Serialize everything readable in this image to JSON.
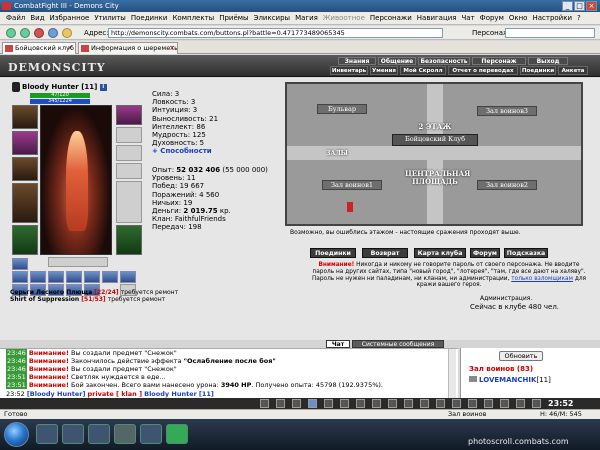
{
  "window": {
    "title": "CombatFight III - Demons City"
  },
  "menu": [
    "Файл",
    "Вид",
    "Избранное",
    "Утилиты",
    "Поединки",
    "Комплекты",
    "Приёмы",
    "Эликсиры",
    "Магия",
    "Живоотное",
    "Персонажи",
    "Навигация",
    "Чат",
    "Форум",
    "Окно",
    "Настройки",
    "?"
  ],
  "address": {
    "label": "Адрес:",
    "url": "http://demonscity.combats.com/buttons.pl?battle=0.471773489065345",
    "person_label": "Персонаж:"
  },
  "tabs": [
    {
      "label": "Бойцовский клуб"
    },
    {
      "label": "Информация о шереметьев"
    }
  ],
  "game": {
    "logo": "DEMONSCITY",
    "topnav": [
      "Знания",
      "Общение",
      "Безопасность",
      "Персонаж",
      "Выход"
    ],
    "subnav": [
      "Инвентарь",
      "Умения",
      "Мой Скролл",
      "Отчет о переводах",
      "Поединки",
      "Анкета"
    ]
  },
  "character": {
    "name": "Bloody Hunter",
    "level": "[11]",
    "hp": "47/120",
    "mana": "345/1224",
    "stats": [
      {
        "label": "Сила:",
        "value": "3"
      },
      {
        "label": "Ловкость:",
        "value": "3"
      },
      {
        "label": "Интуиция:",
        "value": "3"
      },
      {
        "label": "Выносливость:",
        "value": "21"
      },
      {
        "label": "Интеллект:",
        "value": "86"
      },
      {
        "label": "Мудрость:",
        "value": "125"
      },
      {
        "label": "Духовность:",
        "value": "5"
      }
    ],
    "abilities_link": "+ Способности",
    "info": [
      {
        "label": "Опыт:",
        "value": "52 032 406",
        "extra": " (55 000 000)",
        "bold": true
      },
      {
        "label": "Уровень:",
        "value": "11",
        "extra": "",
        "bold": false
      },
      {
        "label": "Побед:",
        "value": "19 667",
        "extra": "",
        "bold": false
      },
      {
        "label": "Поражений:",
        "value": "4 560",
        "extra": "",
        "bold": false
      },
      {
        "label": "Ничьих:",
        "value": "19",
        "extra": "",
        "bold": false
      },
      {
        "label": "Деньги:",
        "value": "2 019.75",
        "extra": " кр.",
        "bold": true
      },
      {
        "label": "Клан:",
        "value": "FaithfulFriends",
        "extra": "",
        "bold": false
      },
      {
        "label": "Передач:",
        "value": "198",
        "extra": "",
        "bold": false
      }
    ],
    "mend": [
      {
        "item": "Серьги Лесного Плюща",
        "count": "[22/24]",
        "note": "требуется ремонт"
      },
      {
        "item": "Shirt of Suppression",
        "count": "[51/53]",
        "note": "требуется ремонт"
      }
    ]
  },
  "map": {
    "labels": {
      "boulevard": "Бульвар",
      "hall3": "Зал воинов3",
      "floor2": "2 ЭТАЖ",
      "club": "Бойцовский Клуб",
      "halls": "ЗАЛЫ",
      "hall1": "Зал воинов1",
      "plaza": "ЦЕНТРАЛЬНАЯ ПЛОЩАДЬ",
      "hall2": "Зал воинов2"
    },
    "hint": "Возможно, вы ошиблись этажом - настоящие сражения проходят выше."
  },
  "actions": [
    "Поединки",
    "Возврат",
    "Карта клуба",
    "Форум",
    "Подсказка"
  ],
  "warning": {
    "label": "Внимание!",
    "text1": " Никогда и никому не говорите пароль от своего персонажа. Не вводите пароль на других сайтах, типа \"новый город\", \"лотерея\", \"там, где все дают на халяву\". Пароль не нужен ни паладинам, ни кланам, ни администрации, ",
    "link": "только взломщикам",
    "text2": " для кражи вашего героя.",
    "admin": "Администрация."
  },
  "online": "Сейчас в клубе 480 чел.",
  "chat": {
    "tabs": [
      "Чат",
      "Системные сообщения"
    ],
    "lines": [
      {
        "time": "23:46",
        "warn": "Внимание!",
        "text": " Вы создали предмет \"Снежок\"",
        "bold": "",
        "after": ""
      },
      {
        "time": "23:46",
        "warn": "Внимание!",
        "text": " Закончилось действие эффекта ",
        "bold": "\"Ослабление после боя\"",
        "after": ""
      },
      {
        "time": "23:46",
        "warn": "Внимание!",
        "text": " Вы создали предмет \"Снежок\"",
        "bold": "",
        "after": ""
      },
      {
        "time": "23:51",
        "warn": "Внимание!",
        "text": " Светляк нуждается в еде...",
        "bold": "",
        "after": ""
      },
      {
        "time": "23:51",
        "warn": "Внимание!",
        "text": " Бой закончен. Всего вами нанесено урона: ",
        "bold": "3940 HP",
        "after": ". Получено опыта: 45798 (192.9375%)."
      }
    ],
    "input": {
      "time": "23:52",
      "from": "[Bloody Hunter]",
      "private": "private [ klan ]",
      "to": "Bloody Hunter",
      "to_level": "[11]"
    }
  },
  "room": {
    "refresh": "Обновить",
    "title": "Зал воинов (83)",
    "user": "LOVEMANCHIK",
    "user_level": "[11]"
  },
  "clock": "23:52",
  "statusbar": {
    "left": "Готово",
    "room": "Зал воинов",
    "mem": "Н: 46/М: 545"
  },
  "watermark": "photoscroll.combats.com"
}
